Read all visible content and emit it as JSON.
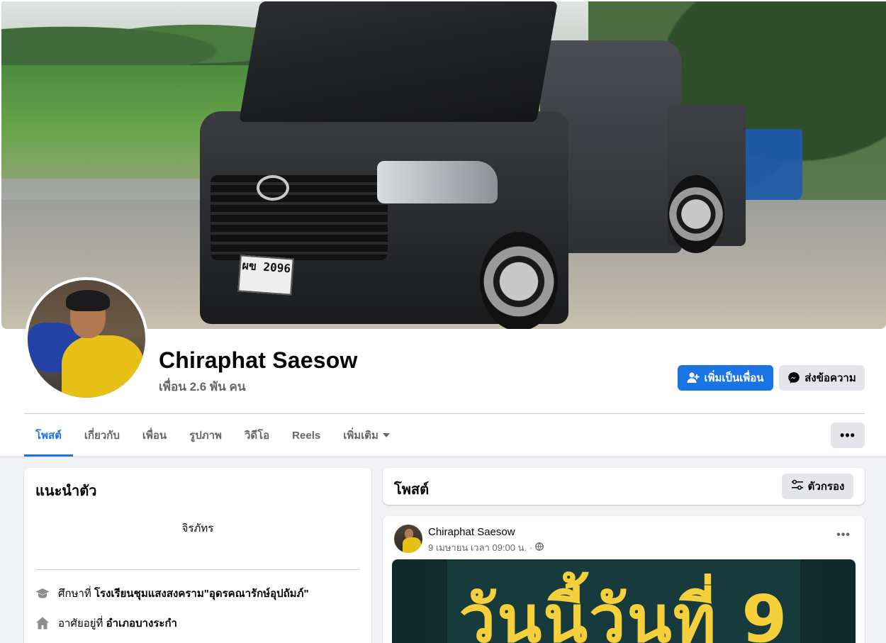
{
  "profile": {
    "name": "Chiraphat Saesow",
    "friends_count": "เพื่อน 2.6 พัน คน",
    "cover_plate": "ผข 2096"
  },
  "actions": {
    "add_friend": "เพิ่มเป็นเพื่อน",
    "message": "ส่งข้อความ",
    "more": "•••"
  },
  "tabs": [
    {
      "label": "โพสต์",
      "active": true
    },
    {
      "label": "เกี่ยวกับ"
    },
    {
      "label": "เพื่อน"
    },
    {
      "label": "รูปภาพ"
    },
    {
      "label": "วิดีโอ"
    },
    {
      "label": "Reels"
    },
    {
      "label": "เพิ่มเติม"
    }
  ],
  "intro": {
    "title": "แนะนำตัว",
    "bio": "จิรภัทร",
    "education_prefix": "ศึกษาที่",
    "education": "โรงเรียนชุมแสงสงคราม\"อุดรคณารักษ์อุปถัมภ์\"",
    "lives_prefix": "อาศัยอยู่ที่",
    "lives": "อำเภอบางระกำ"
  },
  "posts": {
    "title": "โพสต์",
    "filter_label": "ตัวกรอง",
    "items": [
      {
        "author": "Chiraphat Saesow",
        "time": "9 เมษายน เวลา 09:00 น. ·",
        "image_text": "วันนี้วันที่ 9"
      }
    ]
  },
  "colors": {
    "accent": "#1b74e4",
    "image_text": "#f5d03a"
  },
  "icons": {
    "add_friend": "person-plus-icon",
    "message": "messenger-icon",
    "filter": "sliders-icon",
    "education": "graduation-cap-icon",
    "home": "house-icon",
    "privacy": "globe-icon"
  }
}
